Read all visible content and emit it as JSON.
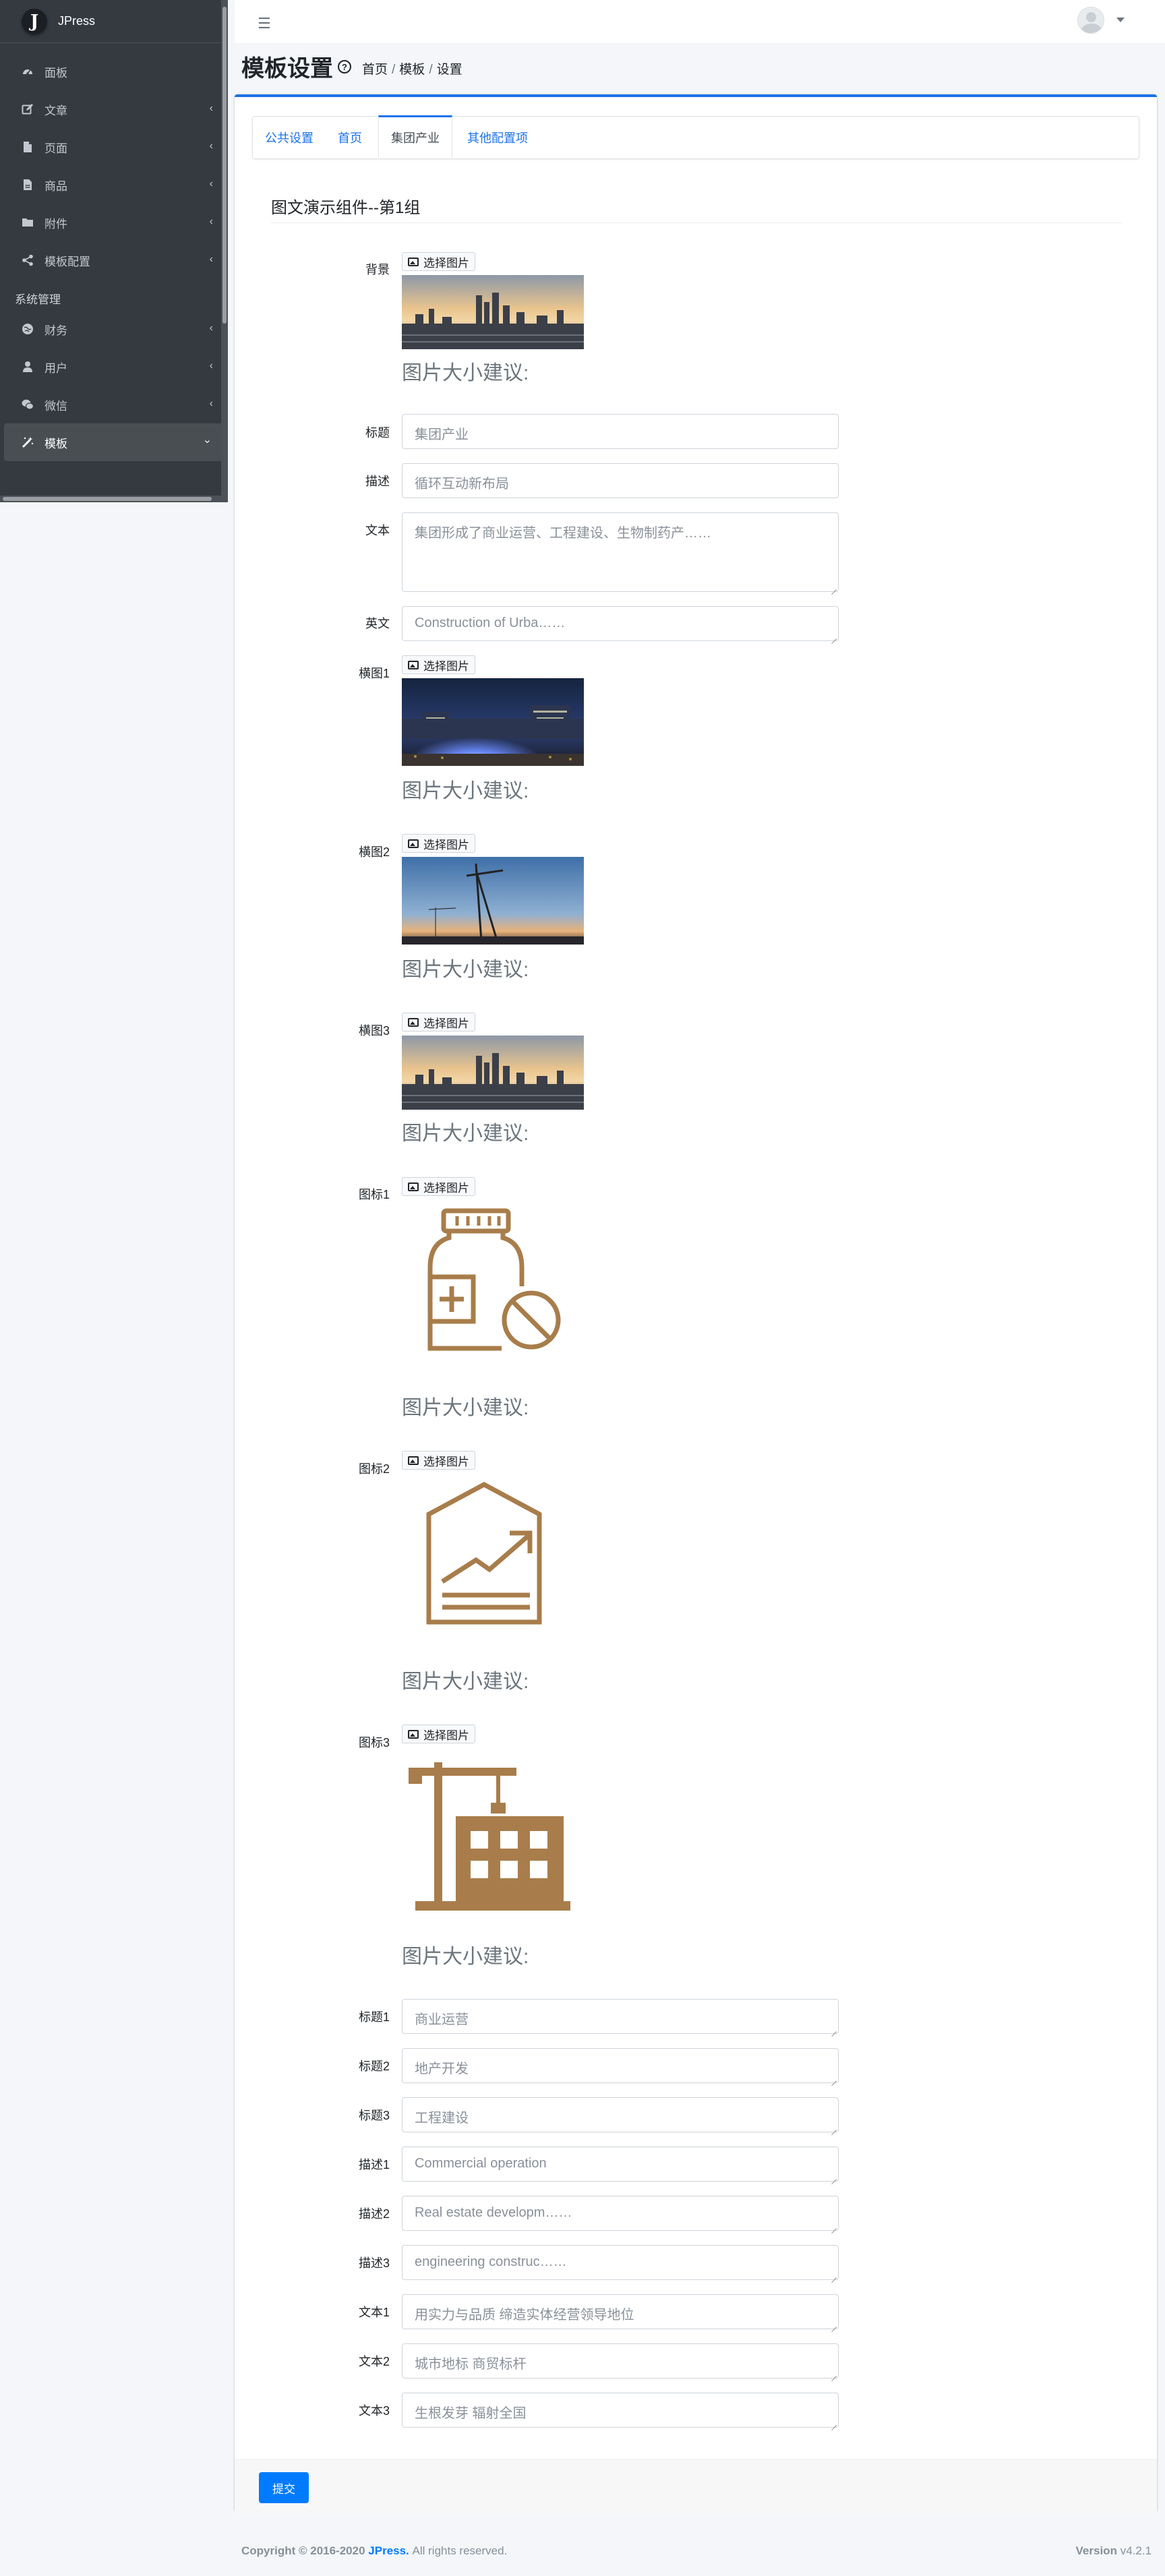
{
  "brand": {
    "logo": "J",
    "name": "JPress"
  },
  "sidebar": {
    "items": [
      {
        "label": "面板",
        "icon": "dashboard-icon",
        "chevron": false
      },
      {
        "label": "文章",
        "icon": "edit-icon",
        "chevron": true
      },
      {
        "label": "页面",
        "icon": "file-icon",
        "chevron": true
      },
      {
        "label": "商品",
        "icon": "file-alt-icon",
        "chevron": true
      },
      {
        "label": "附件",
        "icon": "folder-icon",
        "chevron": true
      },
      {
        "label": "模板配置",
        "icon": "share-icon",
        "chevron": true
      }
    ],
    "header": "系统管理",
    "system_items": [
      {
        "label": "财务",
        "icon": "globe-icon",
        "chevron": true
      },
      {
        "label": "用户",
        "icon": "user-icon",
        "chevron": true
      },
      {
        "label": "微信",
        "icon": "wechat-icon",
        "chevron": true
      },
      {
        "label": "模板",
        "icon": "magic-icon",
        "chevron": true,
        "active": true
      }
    ]
  },
  "header": {
    "title": "模板设置",
    "help": "?",
    "breadcrumb": [
      "首页",
      "模板",
      "设置"
    ],
    "breadcrumb_sep": "/"
  },
  "tabs": [
    {
      "label": "公共设置",
      "active": false
    },
    {
      "label": "首页",
      "active": false
    },
    {
      "label": "集团产业",
      "active": true
    },
    {
      "label": "其他配置项",
      "active": false
    }
  ],
  "section_title": "图文演示组件--第1组",
  "pick_label": "选择图片",
  "size_hint": "图片大小建议:",
  "form": {
    "bg_label": "背景",
    "title_label": "标题",
    "title_value": "集团产业",
    "desc_label": "描述",
    "desc_value": "循环互动新布局",
    "text_label": "文本",
    "text_value": "集团形成了商业运营、工程建设、生物制药产……",
    "en_label": "英文",
    "en_value": "Construction of Urba……",
    "banner1_label": "横图1",
    "banner2_label": "横图2",
    "banner3_label": "横图3",
    "icon1_label": "图标1",
    "icon2_label": "图标2",
    "icon3_label": "图标3",
    "t1_label": "标题1",
    "t1_value": "商业运营",
    "t2_label": "标题2",
    "t2_value": "地产开发",
    "t3_label": "标题3",
    "t3_value": "工程建设",
    "d1_label": "描述1",
    "d1_value": "Commercial operation",
    "d2_label": "描述2",
    "d2_value": "Real estate developm……",
    "d3_label": "描述3",
    "d3_value": "engineering construc……",
    "x1_label": "文本1",
    "x1_value": "用实力与品质 缔造实体经营领导地位",
    "x2_label": "文本2",
    "x2_value": "城市地标 商贸标杆",
    "x3_label": "文本3",
    "x3_value": "生根发芽 辐射全国"
  },
  "submit_label": "提交",
  "footer": {
    "copyright": "Copyright © 2016-2020",
    "brand": "JPress.",
    "rights": "All rights reserved.",
    "version_label": "Version",
    "version": "v4.2.1"
  },
  "colors": {
    "sidebar": "#343a40",
    "primary": "#007bff",
    "icon_gold": "#a87d4b"
  }
}
